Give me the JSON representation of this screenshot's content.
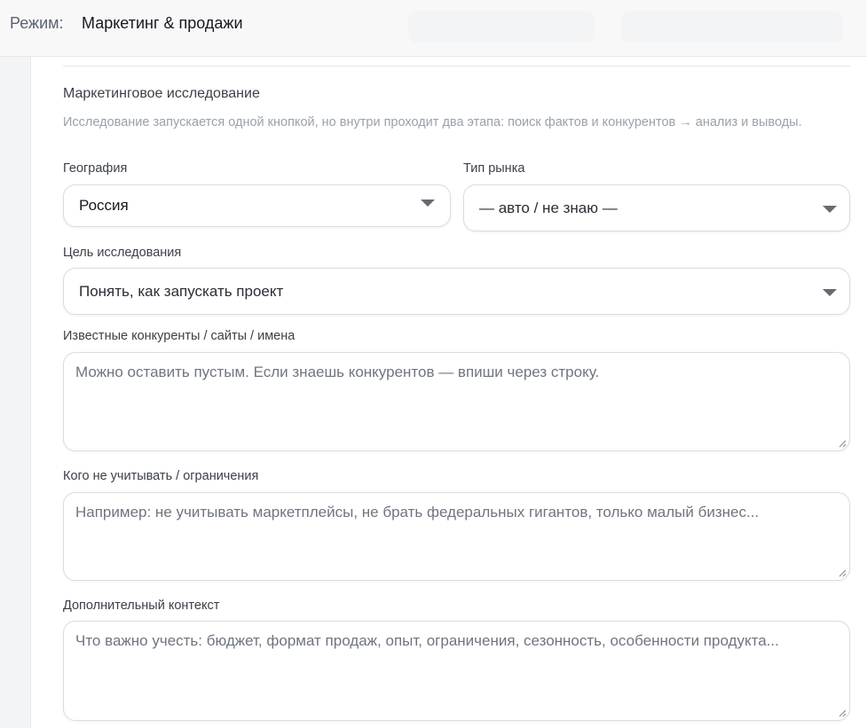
{
  "header": {
    "mode_label": "Режим:",
    "mode_value": "Маркетинг & продажи"
  },
  "section": {
    "title": "Маркетинговое исследование",
    "hint": "Исследование запускается одной кнопкой, но внутри проходит два этапа: поиск фактов и конкурентов → анализ и выводы."
  },
  "fields": {
    "geography": {
      "label": "География",
      "value": "Россия"
    },
    "market_type": {
      "label": "Тип рынка",
      "value": "— авто / не знаю —"
    },
    "goal": {
      "label": "Цель исследования",
      "value": "Понять, как запускать проект"
    },
    "competitors": {
      "label": "Известные конкуренты / сайты / имена",
      "placeholder": "Можно оставить пустым. Если знаешь конкурентов — впиши через строку."
    },
    "exclusions": {
      "label": "Кого не учитывать / ограничения",
      "placeholder": "Например: не учитывать маркетплейсы, не брать федеральных гигантов, только малый бизнес..."
    },
    "context": {
      "label": "Дополнительный контекст",
      "placeholder": "Что важно учесть: бюджет, формат продаж, опыт, ограничения, сезонность, особенности продукта..."
    }
  },
  "icons": {
    "dropdown": "chevron-down-icon",
    "resize": "resize-grip-icon"
  },
  "colors": {
    "panel_bg": "#ffffff",
    "page_bg": "#f3f4f6",
    "label_text": "#3a3f47",
    "hint_text": "#9aa1ab",
    "placeholder_text": "#6f7580",
    "border": "#d9dce1"
  }
}
